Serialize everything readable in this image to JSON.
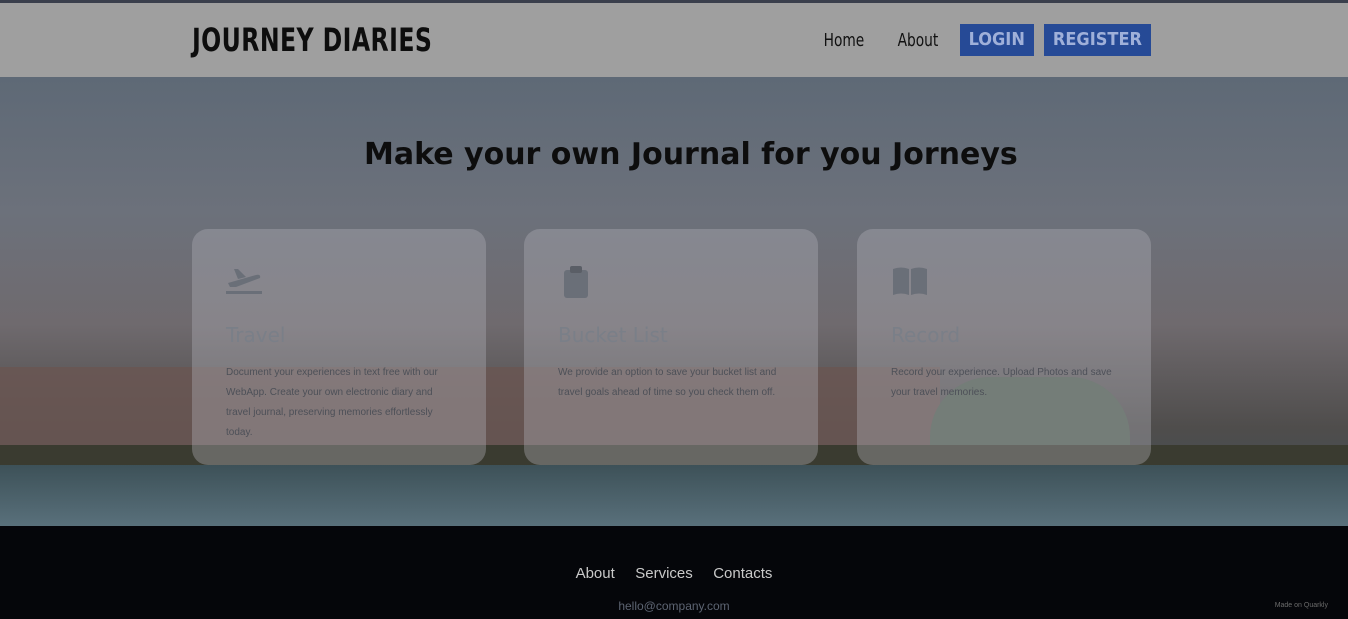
{
  "header": {
    "brand": "JOURNEY DIARIES",
    "nav": {
      "home": "Home",
      "about": "About",
      "login": "LOGIN",
      "register": "REGISTER"
    }
  },
  "hero": {
    "title": "Make your own Journal for you Jorneys",
    "cards": [
      {
        "icon": "airplane-icon",
        "title": "Travel",
        "desc": "Document your experiences in text free with our WebApp. Create your own electronic diary and travel journal, preserving memories effortlessly today."
      },
      {
        "icon": "clipboard-icon",
        "title": "Bucket List",
        "desc": "We provide an option to save your bucket list and travel goals ahead of time so you check them off."
      },
      {
        "icon": "book-icon",
        "title": "Record",
        "desc": "Record your experience. Upload Photos and save your travel memories."
      }
    ]
  },
  "footer": {
    "links": [
      "About",
      "Services",
      "Contacts"
    ],
    "email": "hello@company.com",
    "made": "Made on Quarkly"
  },
  "colors": {
    "header_bg": "#9f9f9f",
    "button_bg": "#264a96",
    "footer_bg": "#05060a"
  }
}
